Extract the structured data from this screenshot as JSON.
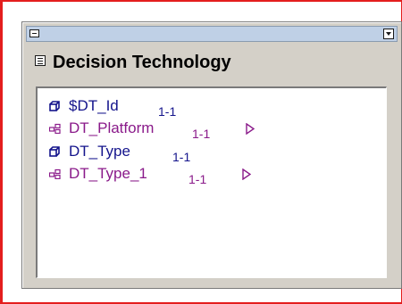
{
  "entity": {
    "title": "Decision Technology",
    "attributes": [
      {
        "name": "$DT_Id",
        "cardinality": "1-1",
        "kind": "key",
        "icon": "cube-icon",
        "has_link_arrow": false
      },
      {
        "name": "DT_Platform",
        "cardinality": "1-1",
        "kind": "foreign",
        "icon": "relation-icon",
        "has_link_arrow": true
      },
      {
        "name": "DT_Type",
        "cardinality": "1-1",
        "kind": "key",
        "icon": "cube-icon",
        "has_link_arrow": false
      },
      {
        "name": "DT_Type_1",
        "cardinality": "1-1",
        "kind": "foreign",
        "icon": "relation-icon",
        "has_link_arrow": true
      }
    ]
  },
  "colors": {
    "frame": "#e41e1e",
    "title_strip": "#bfd0e6",
    "key_text": "#14148c",
    "foreign_text": "#8a1a8a"
  }
}
